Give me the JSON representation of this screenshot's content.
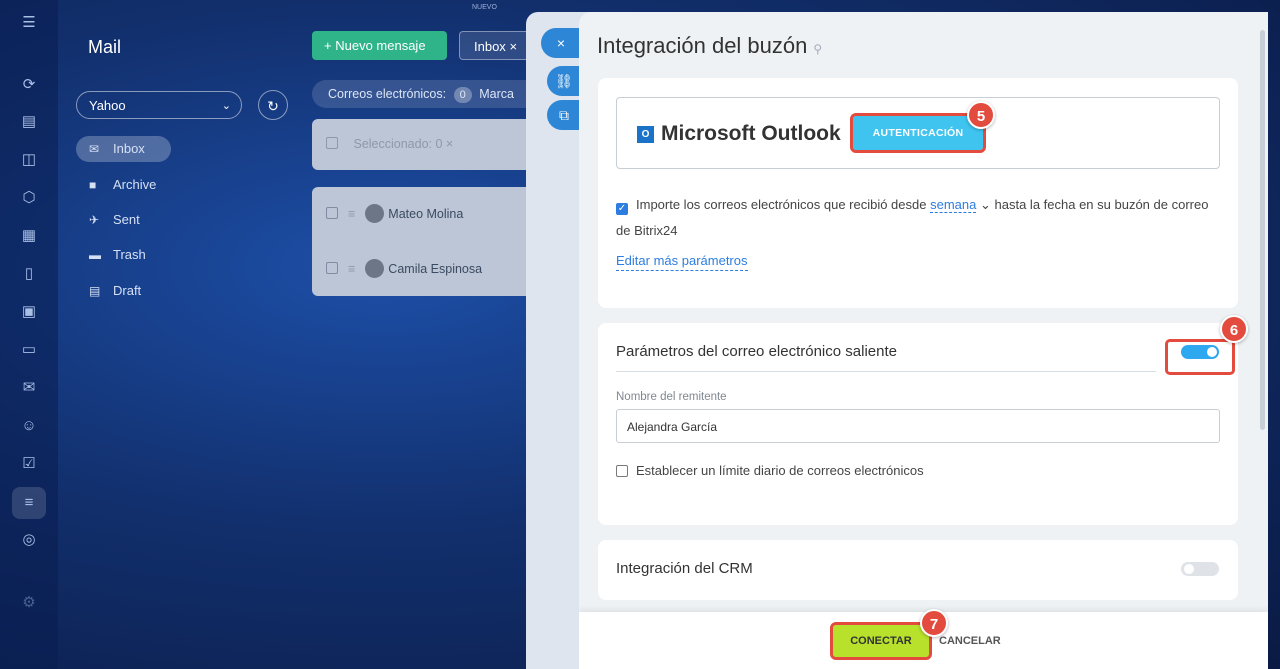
{
  "app": {
    "title": "Mail",
    "new_tag": "NUEVO"
  },
  "rail_icons": [
    "menu-icon",
    "activity-icon",
    "tasks-icon",
    "chat-icon",
    "hexagon-icon",
    "calendar-icon",
    "documents-icon",
    "presentation-icon",
    "card-icon",
    "mail-icon",
    "contacts-icon",
    "checklist-icon",
    "filter-icon",
    "robot-icon",
    "settings-icon"
  ],
  "sidebar": {
    "account": "Yahoo",
    "folders": [
      {
        "label": "Inbox",
        "icon": "inbox-icon"
      },
      {
        "label": "Archive",
        "icon": "folder-icon"
      },
      {
        "label": "Sent",
        "icon": "sent-icon"
      },
      {
        "label": "Trash",
        "icon": "trash-icon"
      },
      {
        "label": "Draft",
        "icon": "draft-icon"
      }
    ]
  },
  "toolbar": {
    "new_message": "Nuevo mensaje",
    "inbox_tab": "Inbox"
  },
  "counter": {
    "label": "Correos electrónicos:",
    "count": "0",
    "marked": "Marca"
  },
  "selection": {
    "label": "Seleccionado: 0"
  },
  "messages": [
    {
      "sender": "Mateo Molina"
    },
    {
      "sender": "Camila Espinosa"
    }
  ],
  "slider": {
    "title": "Integración del buzón",
    "provider": "Microsoft Outlook",
    "provider_logo": "O",
    "auth_button": "AUTENTICACIÓN",
    "import_prefix": "Importe los correos electrónicos que recibió desde",
    "import_period": "semana",
    "import_suffix": "hasta la fecha en su buzón de correo de Bitrix24",
    "edit_params": "Editar más parámetros",
    "outgoing_title": "Parámetros del correo electrónico saliente",
    "sender_label": "Nombre del remitente",
    "sender_value": "Alejandra García",
    "daily_limit": "Establecer un límite diario de correos electrónicos",
    "crm_title": "Integración del CRM",
    "connect": "CONECTAR",
    "cancel": "CANCELAR"
  },
  "steps": [
    "5",
    "6",
    "7"
  ],
  "toggles": {
    "outgoing": true,
    "crm": false
  },
  "colors": {
    "accent": "#2ea9f0",
    "connect": "#b7e12a",
    "marker": "#e24b3d",
    "auth": "#3fc3ef"
  }
}
